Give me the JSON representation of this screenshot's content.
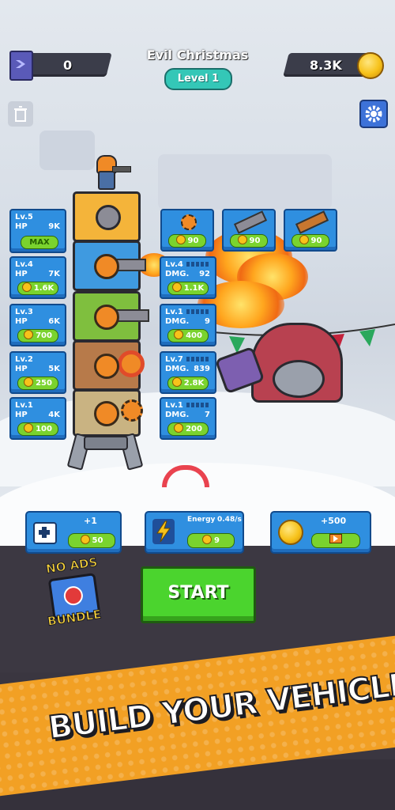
{
  "topbar": {
    "left_count": "0",
    "stage_title": "Evil Christmas",
    "level_label": "Level 1",
    "coins": "8.3K"
  },
  "hp_cards": [
    {
      "level": "Lv.5",
      "hp_label": "HP",
      "hp": "9K",
      "price": "MAX"
    },
    {
      "level": "Lv.4",
      "hp_label": "HP",
      "hp": "7K",
      "price": "1.6K"
    },
    {
      "level": "Lv.3",
      "hp_label": "HP",
      "hp": "6K",
      "price": "700"
    },
    {
      "level": "Lv.2",
      "hp_label": "HP",
      "hp": "5K",
      "price": "250"
    },
    {
      "level": "Lv.1",
      "hp_label": "HP",
      "hp": "4K",
      "price": "100"
    }
  ],
  "dmg_cards": [
    {
      "level": "Lv.4",
      "dmg_label": "DMG.",
      "dmg": "92",
      "price": "1.1K"
    },
    {
      "level": "Lv.1",
      "dmg_label": "DMG.",
      "dmg": "9",
      "price": "400"
    },
    {
      "level": "Lv.7",
      "dmg_label": "DMG.",
      "dmg": "839",
      "price": "2.8K"
    },
    {
      "level": "Lv.1",
      "dmg_label": "DMG.",
      "dmg": "7",
      "price": "200"
    }
  ],
  "weapon_shop": [
    {
      "icon": "saw-blade-icon",
      "price": "90"
    },
    {
      "icon": "cannon-icon",
      "price": "90"
    },
    {
      "icon": "chainsaw-icon",
      "price": "90"
    }
  ],
  "boosts": {
    "heal": {
      "label": "+1",
      "price": "50"
    },
    "energy": {
      "label": "Energy",
      "rate": "0.48/s",
      "price": "9"
    },
    "coins": {
      "label": "+500"
    }
  },
  "start_label": "START",
  "no_ads": {
    "line1": "NO ADS",
    "line2": "BUNDLE"
  },
  "banner_text": "BUILD YOUR VEHICLE",
  "colors": {
    "card_blue": "#2f8fe0",
    "buy_green": "#7ad32e",
    "start_green": "#4bd42e",
    "banner_orange": "#f2a024"
  }
}
